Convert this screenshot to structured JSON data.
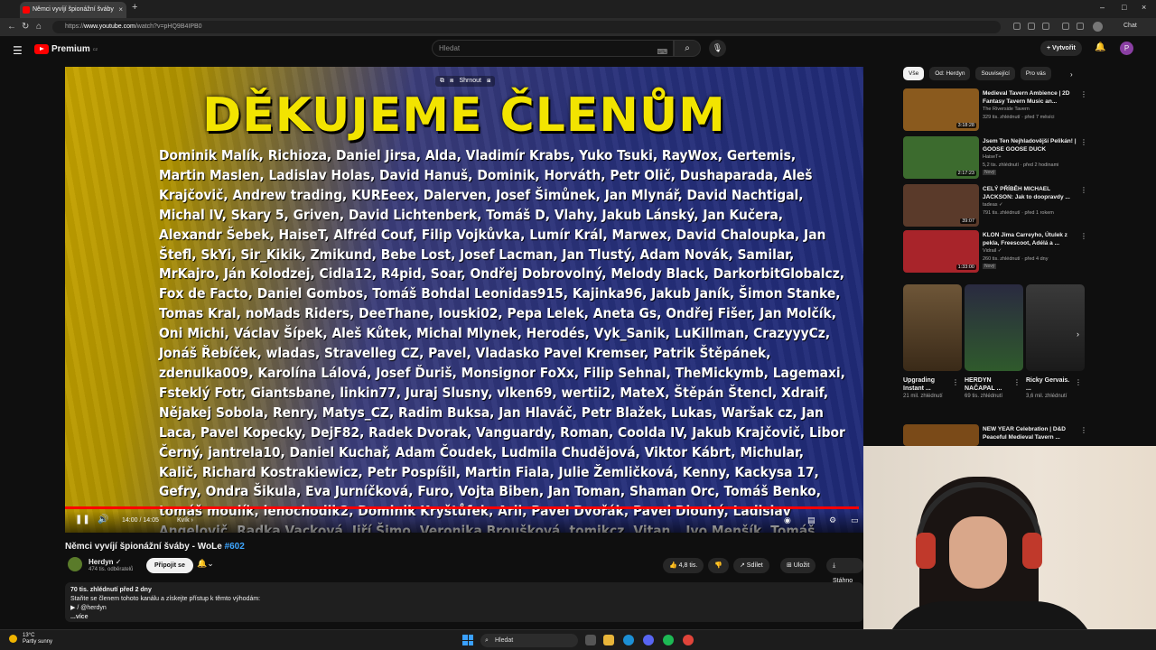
{
  "browser": {
    "tab_title": "Němci vyvíjí špionážní šváby",
    "tab_close": "×",
    "new_tab": "+",
    "url_prefix": "https://",
    "url_domain": "www.youtube.com",
    "url_path": "/watch?v=pHQ9B4IPB0",
    "chat_label": "Chat",
    "minimize": "–",
    "maximize": "□",
    "close": "×"
  },
  "youtube": {
    "logo_text": "Premium",
    "logo_sup": "CZ",
    "search_placeholder": "Hledat",
    "create_label": "+ Vytvořit",
    "avatar_letter": "P"
  },
  "player": {
    "overlay_items": [
      "⧉",
      "⧈",
      "Shrnout",
      "⧆"
    ],
    "headline": "DĚKUJEME ČLENŮM",
    "names_text": "Dominik Malík, Richioza, Daniel Jirsa, Alda, Vladimír Krabs, Yuko Tsuki, RayWox, Gertemis, Martin Maslen, Ladislav Holas, David Hanuš, Dominik, Horváth, Petr Olič, Dushaparada, Aleš Krajčovič, Andrew trading, KUREeex, Dalerven, Josef Šimůnek, Jan Mlynář, David Nachtigal, Michal IV, Skary 5, Griven, David Lichtenberk, Tomáš D, Vlahy, Jakub Lánský, Jan Kučera, Alexandr Šebek, HaiseT, Alfréd Couf, Filip Vojkůvka, Lumír Král, Marwex, David Chaloupka, Jan Štefl, SkYi, Sir_Kikik, Zmikund, Bebe Lost, Josef Lacman, Jan Tlustý, Adam Novák, Samilar, MrKajro, Ján Kolodzej, Cidla12, R4pid, Soar, Ondřej Dobrovolný, Melody Black, DarkorbitGlobalcz, Fox de Facto, Daniel Gombos, Tomáš Bohdal Leonidas915, Kajinka96, Jakub Janík, Šimon Stanke, Tomas Kral, noMads Riders, DeeThane, Iouski02, Pepa Lelek, Aneta Gs, Ondřej Fišer, Jan Molčík, Oni Michi, Václav Šípek, Aleš Kůtek, Michal Mlynek, Herodés, Vyk_Sanik, LuKillman, CrazyyyCz, Jonáš Řebíček, wladas, Stravelleg CZ, Pavel, Vladasko Pavel Kremser, Patrik Štěpánek, zdenulka009, Karolína Lálová, Josef Ďuriš, Monsignor FoXx, Filip Sehnal, TheMickymb, Lagemaxi, Fsteklý Fotr, Giantsbane, linkin77, Juraj Slusny, vlken69, wertii2, MateX, Štěpán Štencl, Xdraif, Nějakej Sobola, Renry, Matys_CZ, Radim Buksa, Jan Hlaváč, Petr Blažek, Lukas, Waršak cz, Jan Laca, Pavel Kopecky, DejF82, Radek Dvorak, Vanguardy, Roman, Coolda IV, Jakub Krajčovič, Libor Černý, jantrela10, Daniel Kuchař, Adam Čoudek, Ludmila Chudějová, Viktor Kábrt, Michular, Kalič, Richard Kostrakiewicz, Petr Pospíšil, Martin Fiala, Julie Žemličková, Kenny, Kackysa 17, Gefry, Ondra Šikula, Eva Jurníčková, Furo, Vojta Biben, Jan Toman, Shaman Orc, Tomáš Benko, tomáš moulík, lenochodik2, Dominik Kryštůfek, Arii, Pavel Dvořák, Pavel Dlouhý, Ladislav Angelovič, Radka Vacková, Jiří Šimo, Veronika Broušková, tomikcz, Vitan_, Ivo Menšík, Tomáš Proch",
    "time": "14:00 / 14:05",
    "chapter": "Kvík ›",
    "progress": 0.994
  },
  "video": {
    "title": "Němci vyvíjí špionážní šváby - WoLe",
    "title_tag": "#602",
    "channel_name": "Herdyn ✓",
    "subscribers": "474 tis. odběratelů",
    "join_label": "Připojit se",
    "like_count": "👍 4,8 tis.",
    "dislike": "👎",
    "share_label": "↗ Sdílet",
    "save_label": "⊞ Uložit",
    "download_label": "⤓ Stáhno",
    "desc_views": "70 tis. zhlédnutí  před 2 dny",
    "desc_line": "Staňte se členem tohoto kanálu a získejte přístup k těmto výhodám:",
    "desc_link": "▶ / @herdyn",
    "desc_more": "...více"
  },
  "chips": [
    "Vše",
    "Od: Herdyn",
    "Související",
    "Pro vás"
  ],
  "recs": [
    {
      "title": "Medieval Tavern Ambience | 2D Fantasy Tavern Music an...",
      "channel": "The Riverside Tavern",
      "views": "329 tis. zhlédnutí · před 7 měsíci",
      "duration": "3:18:28",
      "new": "",
      "color": "#8a5a1e"
    },
    {
      "title": "Jsem Ten Nejhladovější Pelikán! | GOOSE GOOSE DUCK",
      "channel": "HaiseT+",
      "views": "5,2 tis. zhlédnutí · před 2 hodinami",
      "duration": "2:17:23",
      "new": "Nový",
      "color": "#3c6b2e"
    },
    {
      "title": "CELÝ PŘÍBĚH MICHAEL JACKSON: Jak to doopravdy ...",
      "channel": "tadeas ✓",
      "views": "791 tis. zhlédnutí · před 1 rokem",
      "duration": "39:07",
      "new": "",
      "color": "#5a3a2a"
    },
    {
      "title": "KLON Jima Carreyho, Útulek z pekla, Freescoot, Adélá a ...",
      "channel": "Vidrail ✓",
      "views": "260 tis. zhlédnutí · před 4 dny",
      "duration": "1:33:00",
      "new": "Nový",
      "color": "#a8242a"
    },
    {
      "title": "NEW YEAR Celebration | D&D Peaceful Medieval Tavern ...",
      "channel": "",
      "views": "",
      "duration": "",
      "new": "",
      "color": "#7a4a18"
    }
  ],
  "shorts": [
    {
      "title": "Upgrading Instant ...",
      "views": "21 mil. zhlédnutí",
      "color": "#6e5638"
    },
    {
      "title": "HERDYN NAČAPAL ...",
      "views": "69 tis. zhlédnutí",
      "color": "#2f5a2c"
    },
    {
      "title": "Ricky Gervais. ...",
      "views": "3,6 mil. zhlédnutí",
      "color": "#2a2a2a"
    }
  ],
  "taskbar": {
    "temp": "13°C",
    "weather": "Partly sunny",
    "search": "Hledat"
  }
}
